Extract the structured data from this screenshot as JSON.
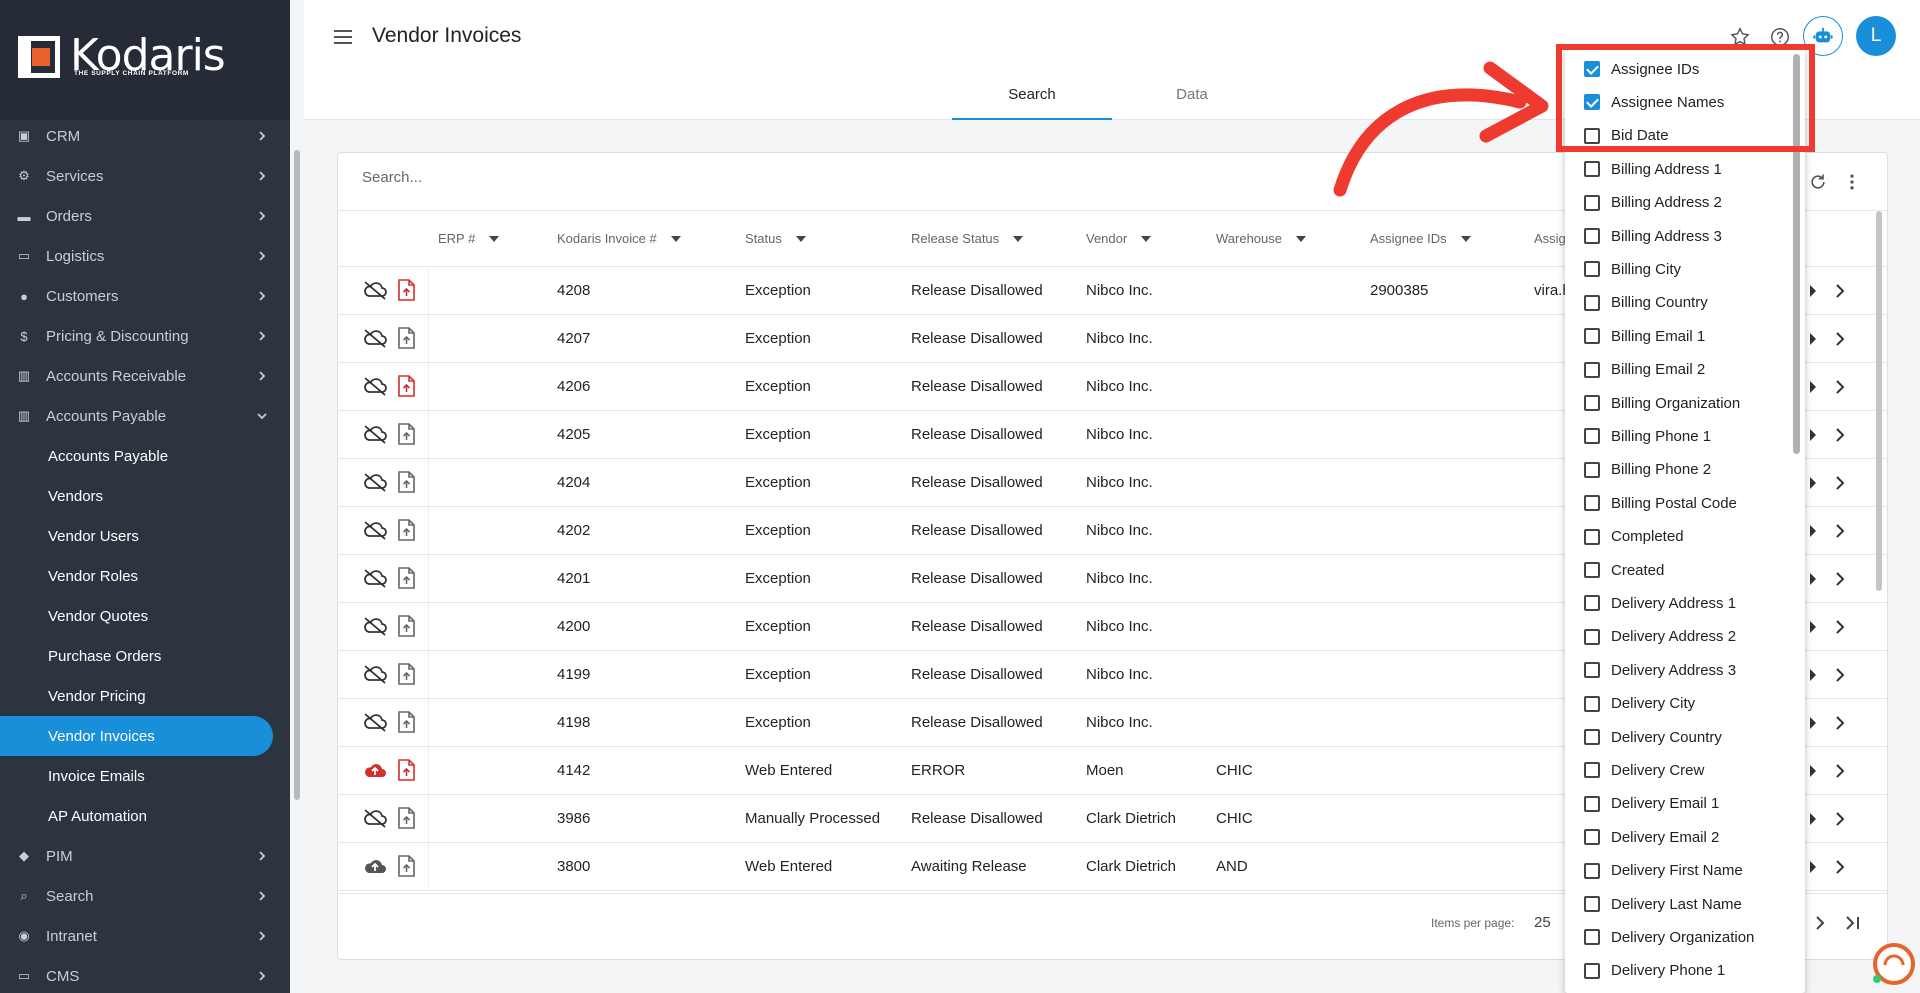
{
  "brand": {
    "name": "Kodaris",
    "tagline": "THE SUPPLY CHAIN PLATFORM"
  },
  "sidebar": {
    "items": [
      {
        "label": "CRM",
        "icon": "contact-book-icon"
      },
      {
        "label": "Services",
        "icon": "gears-icon"
      },
      {
        "label": "Orders",
        "icon": "truck-icon"
      },
      {
        "label": "Logistics",
        "icon": "van-icon"
      },
      {
        "label": "Customers",
        "icon": "people-icon"
      },
      {
        "label": "Pricing & Discounting",
        "icon": "dollar-icon"
      },
      {
        "label": "Accounts Receivable",
        "icon": "bank-icon"
      },
      {
        "label": "Accounts Payable",
        "icon": "bank-icon"
      }
    ],
    "sub_items": [
      "Accounts Payable",
      "Vendors",
      "Vendor Users",
      "Vendor Roles",
      "Vendor Quotes",
      "Purchase Orders",
      "Vendor Pricing",
      "Vendor Invoices",
      "Invoice Emails",
      "AP Automation"
    ],
    "active_sub": "Vendor Invoices",
    "bottom_items": [
      {
        "label": "PIM",
        "icon": "tag-icon"
      },
      {
        "label": "Search",
        "icon": "search-icon"
      },
      {
        "label": "Intranet",
        "icon": "globe-icon"
      },
      {
        "label": "CMS",
        "icon": "monitor-icon"
      }
    ]
  },
  "header": {
    "title": "Vendor Invoices",
    "avatar_initial": "L"
  },
  "tabs": [
    {
      "label": "Search",
      "active": true
    },
    {
      "label": "Data",
      "active": false
    }
  ],
  "search": {
    "placeholder": "Search..."
  },
  "table": {
    "columns": [
      "ERP #",
      "Kodaris Invoice #",
      "Status",
      "Release Status",
      "Vendor",
      "Warehouse",
      "Assignee IDs",
      "Assig"
    ],
    "rows": [
      {
        "cloud": "off",
        "doc": "red",
        "invoice": "4208",
        "status": "Exception",
        "release": "Release Disallowed",
        "vendor": "Nibco Inc.",
        "warehouse": "",
        "assignee_ids": "2900385",
        "assignee": "vira.h"
      },
      {
        "cloud": "off",
        "doc": "grey",
        "invoice": "4207",
        "status": "Exception",
        "release": "Release Disallowed",
        "vendor": "Nibco Inc.",
        "warehouse": "",
        "assignee_ids": "",
        "assignee": ""
      },
      {
        "cloud": "off",
        "doc": "red",
        "invoice": "4206",
        "status": "Exception",
        "release": "Release Disallowed",
        "vendor": "Nibco Inc.",
        "warehouse": "",
        "assignee_ids": "",
        "assignee": ""
      },
      {
        "cloud": "off",
        "doc": "grey",
        "invoice": "4205",
        "status": "Exception",
        "release": "Release Disallowed",
        "vendor": "Nibco Inc.",
        "warehouse": "",
        "assignee_ids": "",
        "assignee": ""
      },
      {
        "cloud": "off",
        "doc": "grey",
        "invoice": "4204",
        "status": "Exception",
        "release": "Release Disallowed",
        "vendor": "Nibco Inc.",
        "warehouse": "",
        "assignee_ids": "",
        "assignee": ""
      },
      {
        "cloud": "off",
        "doc": "grey",
        "invoice": "4202",
        "status": "Exception",
        "release": "Release Disallowed",
        "vendor": "Nibco Inc.",
        "warehouse": "",
        "assignee_ids": "",
        "assignee": ""
      },
      {
        "cloud": "off",
        "doc": "grey",
        "invoice": "4201",
        "status": "Exception",
        "release": "Release Disallowed",
        "vendor": "Nibco Inc.",
        "warehouse": "",
        "assignee_ids": "",
        "assignee": ""
      },
      {
        "cloud": "off",
        "doc": "grey",
        "invoice": "4200",
        "status": "Exception",
        "release": "Release Disallowed",
        "vendor": "Nibco Inc.",
        "warehouse": "",
        "assignee_ids": "",
        "assignee": ""
      },
      {
        "cloud": "off",
        "doc": "grey",
        "invoice": "4199",
        "status": "Exception",
        "release": "Release Disallowed",
        "vendor": "Nibco Inc.",
        "warehouse": "",
        "assignee_ids": "",
        "assignee": ""
      },
      {
        "cloud": "off",
        "doc": "grey",
        "invoice": "4198",
        "status": "Exception",
        "release": "Release Disallowed",
        "vendor": "Nibco Inc.",
        "warehouse": "",
        "assignee_ids": "",
        "assignee": ""
      },
      {
        "cloud": "up-red",
        "doc": "red",
        "invoice": "4142",
        "status": "Web Entered",
        "release": "ERROR",
        "vendor": "Moen",
        "warehouse": "CHIC",
        "assignee_ids": "",
        "assignee": ""
      },
      {
        "cloud": "off",
        "doc": "grey",
        "invoice": "3986",
        "status": "Manually Processed",
        "release": "Release Disallowed",
        "vendor": "Clark Dietrich",
        "warehouse": "CHIC",
        "assignee_ids": "",
        "assignee": ""
      },
      {
        "cloud": "up-grey",
        "doc": "grey",
        "invoice": "3800",
        "status": "Web Entered",
        "release": "Awaiting Release",
        "vendor": "Clark Dietrich",
        "warehouse": "AND",
        "assignee_ids": "",
        "assignee": ""
      }
    ]
  },
  "pagination": {
    "items_per_page_label": "Items per page:",
    "items_per_page": "25"
  },
  "column_menu": {
    "items": [
      {
        "label": "Assignee IDs",
        "checked": true
      },
      {
        "label": "Assignee Names",
        "checked": true
      },
      {
        "label": "Bid Date",
        "checked": false
      },
      {
        "label": "Billing Address 1",
        "checked": false
      },
      {
        "label": "Billing Address 2",
        "checked": false
      },
      {
        "label": "Billing Address 3",
        "checked": false
      },
      {
        "label": "Billing City",
        "checked": false
      },
      {
        "label": "Billing Country",
        "checked": false
      },
      {
        "label": "Billing Email 1",
        "checked": false
      },
      {
        "label": "Billing Email 2",
        "checked": false
      },
      {
        "label": "Billing Organization",
        "checked": false
      },
      {
        "label": "Billing Phone 1",
        "checked": false
      },
      {
        "label": "Billing Phone 2",
        "checked": false
      },
      {
        "label": "Billing Postal Code",
        "checked": false
      },
      {
        "label": "Completed",
        "checked": false
      },
      {
        "label": "Created",
        "checked": false
      },
      {
        "label": "Delivery Address 1",
        "checked": false
      },
      {
        "label": "Delivery Address 2",
        "checked": false
      },
      {
        "label": "Delivery Address 3",
        "checked": false
      },
      {
        "label": "Delivery City",
        "checked": false
      },
      {
        "label": "Delivery Country",
        "checked": false
      },
      {
        "label": "Delivery Crew",
        "checked": false
      },
      {
        "label": "Delivery Email 1",
        "checked": false
      },
      {
        "label": "Delivery Email 2",
        "checked": false
      },
      {
        "label": "Delivery First Name",
        "checked": false
      },
      {
        "label": "Delivery Last Name",
        "checked": false
      },
      {
        "label": "Delivery Organization",
        "checked": false
      },
      {
        "label": "Delivery Phone 1",
        "checked": false
      }
    ]
  },
  "colors": {
    "sidebar_bg": "#2c3440",
    "accent": "#1a8fd9",
    "error_red": "#d32f2f",
    "annotation_red": "#ef3b2f"
  }
}
